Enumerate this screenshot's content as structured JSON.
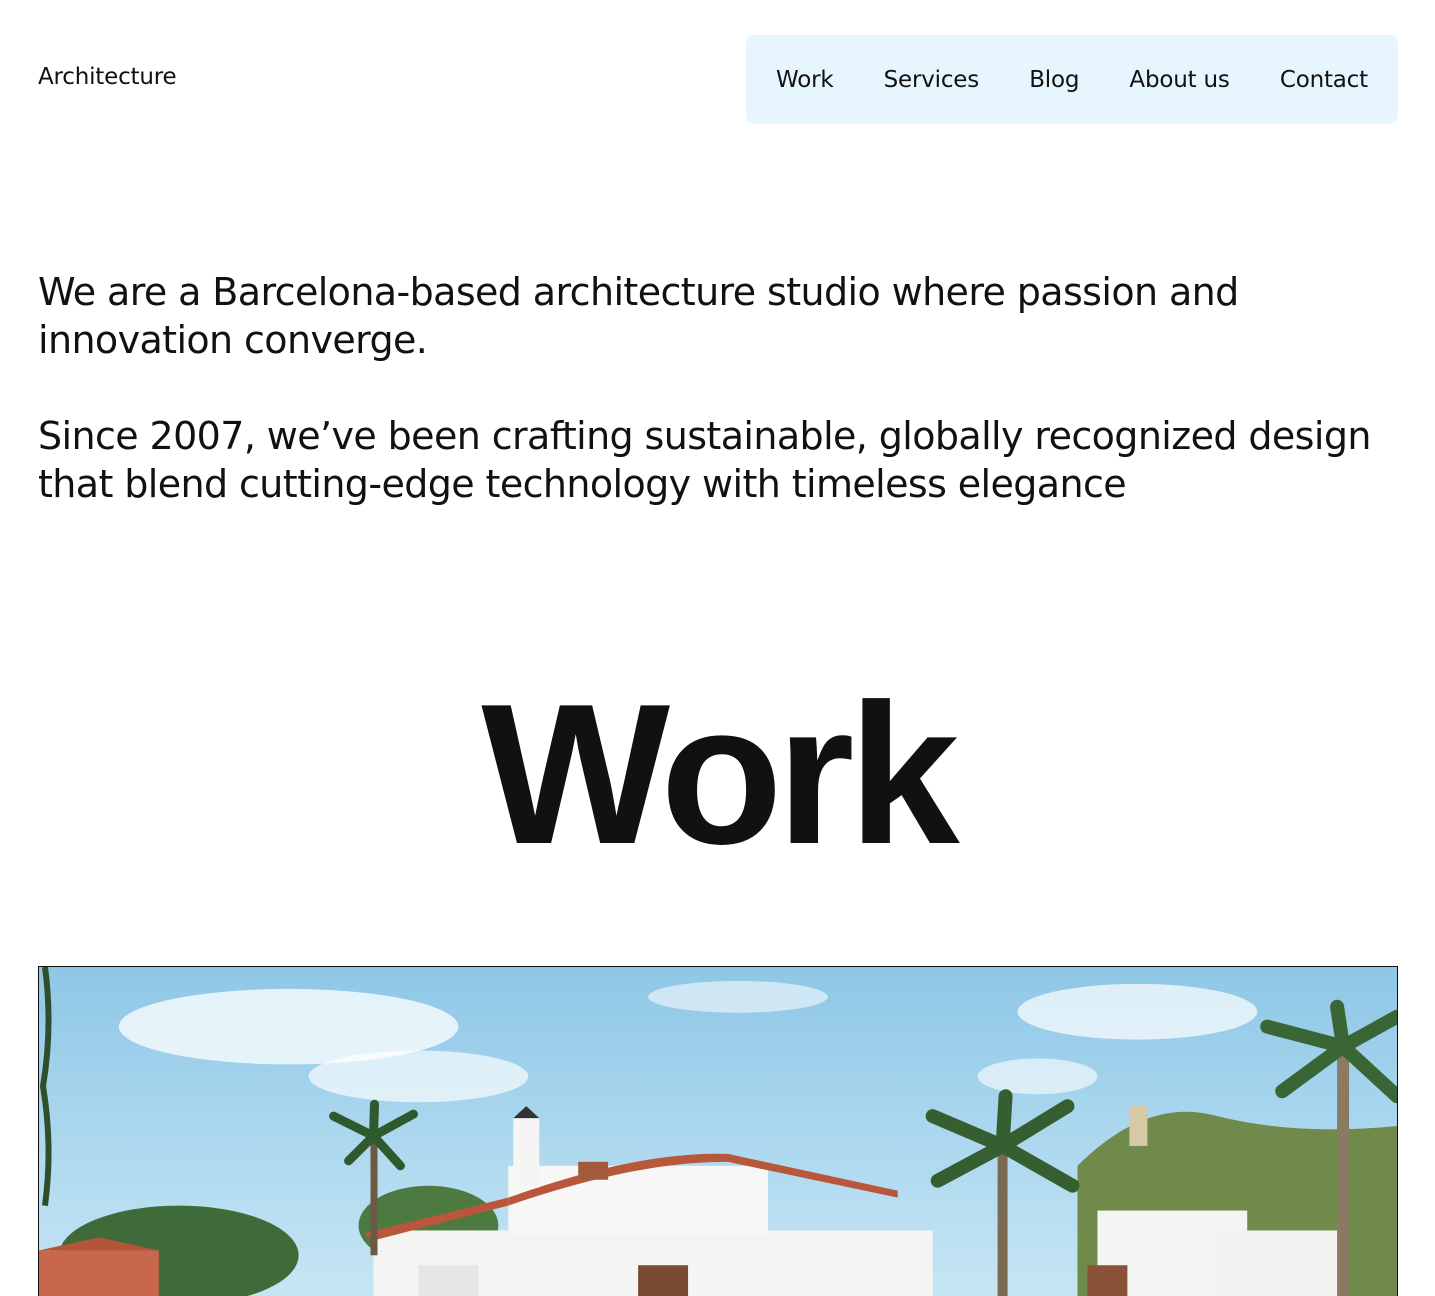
{
  "header": {
    "logo": "Architecture",
    "nav": [
      "Work",
      "Services",
      "Blog",
      "About us",
      "Contact"
    ]
  },
  "intro": {
    "paragraph_1": "We are a Barcelona-based architecture studio where passion and innovation converge.",
    "paragraph_2": "Since 2007, we’ve been crafting sustainable, globally recognized design that blend cutting-edge technology with timeless elegance"
  },
  "work": {
    "title": "Work"
  },
  "colors": {
    "nav_background": "#e7f6fe",
    "text": "#111111"
  }
}
